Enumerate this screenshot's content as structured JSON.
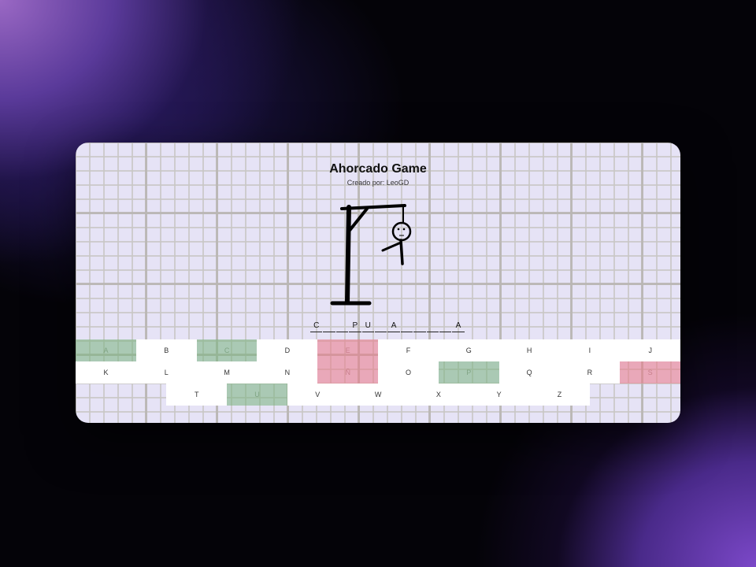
{
  "game": {
    "title": "Ahorcado Game",
    "subtitle": "Creado por: LeoGD"
  },
  "hangman": {
    "parts_drawn": [
      "head",
      "body",
      "left-arm"
    ],
    "face": [
      "eyes",
      "mouth"
    ]
  },
  "word_slots": [
    "C",
    "",
    "",
    "P",
    "U",
    "",
    "A",
    "",
    "",
    "",
    "",
    "A"
  ],
  "colors": {
    "correct": "#7ab47d",
    "wrong": "#eb7887",
    "card": "#e6e3f6"
  },
  "keyboard": {
    "rows": [
      [
        {
          "letter": "A",
          "state": "correct"
        },
        {
          "letter": "B",
          "state": "unused"
        },
        {
          "letter": "C",
          "state": "correct"
        },
        {
          "letter": "D",
          "state": "unused"
        },
        {
          "letter": "E",
          "state": "wrong"
        },
        {
          "letter": "F",
          "state": "unused"
        },
        {
          "letter": "G",
          "state": "unused"
        },
        {
          "letter": "H",
          "state": "unused"
        },
        {
          "letter": "I",
          "state": "unused"
        },
        {
          "letter": "J",
          "state": "unused"
        }
      ],
      [
        {
          "letter": "K",
          "state": "unused"
        },
        {
          "letter": "L",
          "state": "unused"
        },
        {
          "letter": "M",
          "state": "unused"
        },
        {
          "letter": "N",
          "state": "unused"
        },
        {
          "letter": "Ñ",
          "state": "wrong"
        },
        {
          "letter": "O",
          "state": "unused"
        },
        {
          "letter": "P",
          "state": "correct"
        },
        {
          "letter": "Q",
          "state": "unused"
        },
        {
          "letter": "R",
          "state": "unused"
        },
        {
          "letter": "S",
          "state": "wrong"
        }
      ],
      [
        {
          "letter": "T",
          "state": "unused"
        },
        {
          "letter": "U",
          "state": "correct"
        },
        {
          "letter": "V",
          "state": "unused"
        },
        {
          "letter": "W",
          "state": "unused"
        },
        {
          "letter": "X",
          "state": "unused"
        },
        {
          "letter": "Y",
          "state": "unused"
        },
        {
          "letter": "Z",
          "state": "unused"
        }
      ]
    ]
  }
}
